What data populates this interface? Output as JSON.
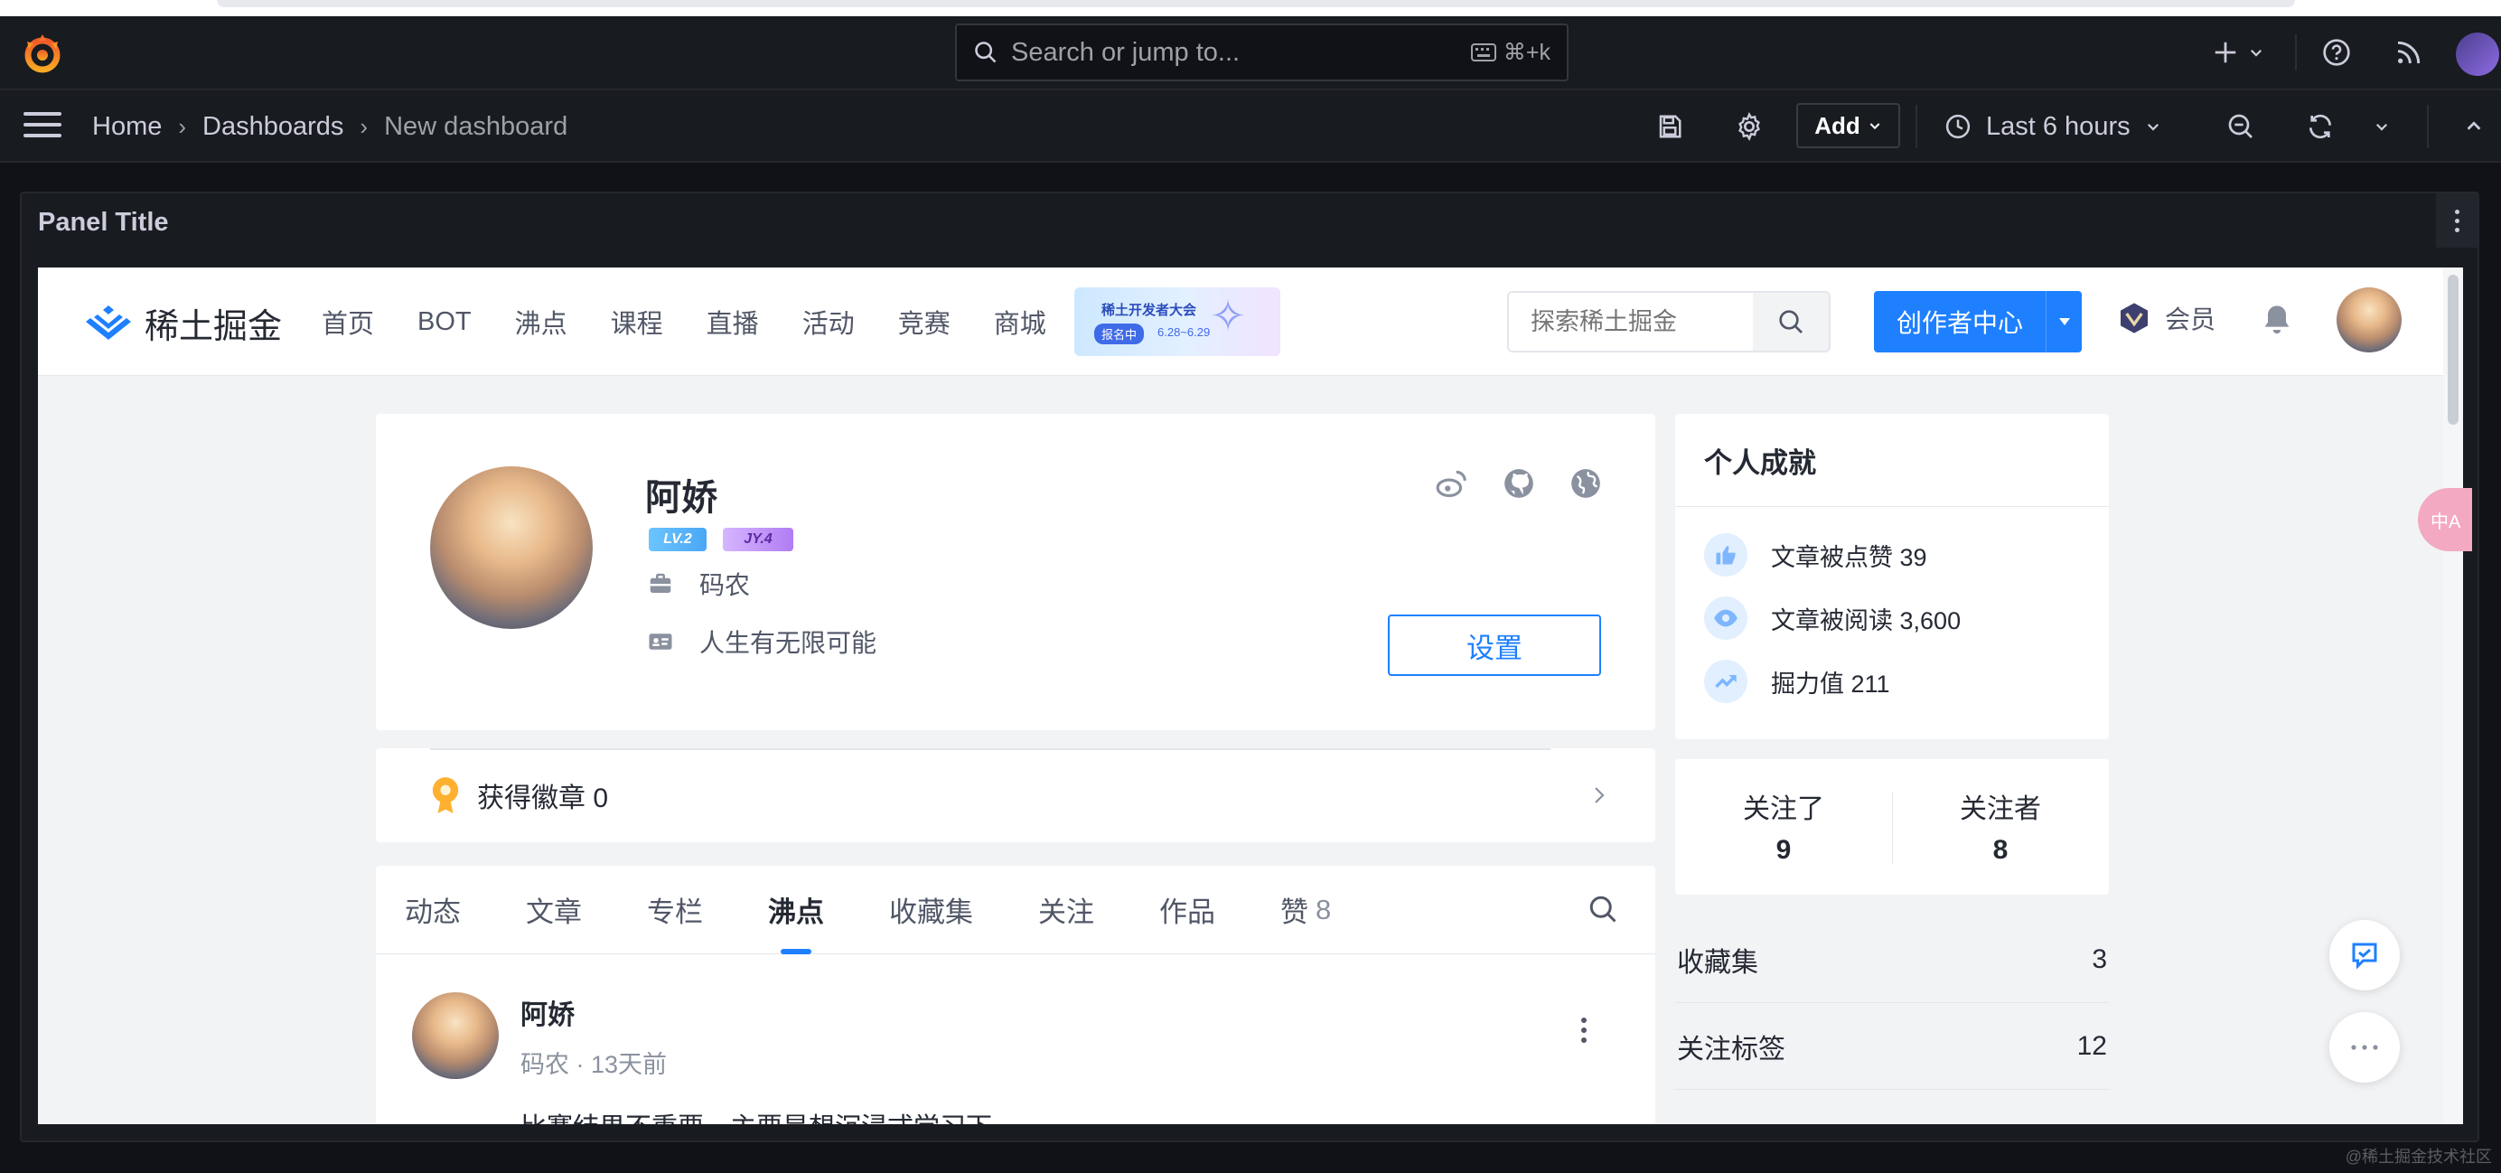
{
  "grafana": {
    "search": {
      "placeholder": "Search or jump to...",
      "shortcut": "⌘+k"
    },
    "breadcrumb": [
      "Home",
      "Dashboards",
      "New dashboard"
    ],
    "toolbar": {
      "add_label": "Add",
      "time_range": "Last 6 hours"
    },
    "panel": {
      "title": "Panel Title"
    }
  },
  "juejin": {
    "logo_text": "稀土掘金",
    "nav_links": [
      "首页",
      "BOT",
      "沸点",
      "课程",
      "直播",
      "活动",
      "竞赛",
      "商城"
    ],
    "banner": {
      "title": "稀土开发者大会",
      "tag": "报名中",
      "dates": "6.28~6.29"
    },
    "search_placeholder": "探索稀土掘金",
    "creator_button": "创作者中心",
    "vip_label": "会员",
    "profile": {
      "name": "阿娇",
      "level_badge": "LV.2",
      "jy_badge": "JY.4",
      "job": "码农",
      "bio": "人生有无限可能",
      "settings_button": "设置"
    },
    "badges": {
      "label": "获得徽章 0"
    },
    "tabs": [
      {
        "label": "动态",
        "count": ""
      },
      {
        "label": "文章",
        "count": ""
      },
      {
        "label": "专栏",
        "count": ""
      },
      {
        "label": "沸点",
        "count": "",
        "active": true
      },
      {
        "label": "收藏集",
        "count": ""
      },
      {
        "label": "关注",
        "count": ""
      },
      {
        "label": "作品",
        "count": ""
      },
      {
        "label": "赞",
        "count": "8"
      }
    ],
    "feed_item": {
      "author": "阿娇",
      "meta": "码农 · 13天前",
      "text": "比赛结果不重要，主要是想沉浸式学习下"
    },
    "achievements": {
      "title": "个人成就",
      "items": [
        {
          "label": "文章被点赞",
          "value": "39",
          "icon": "thumbs-up-icon"
        },
        {
          "label": "文章被阅读",
          "value": "3,600",
          "icon": "eye-icon"
        },
        {
          "label": "掘力值",
          "value": "211",
          "icon": "trend-up-icon"
        }
      ]
    },
    "follow": {
      "following_label": "关注了",
      "following": "9",
      "followers_label": "关注者",
      "followers": "8"
    },
    "stats": [
      {
        "label": "收藏集",
        "value": "3"
      },
      {
        "label": "关注标签",
        "value": "12"
      }
    ],
    "edge_bubble": "中A"
  },
  "watermark": "@稀土掘金技术社区",
  "colors": {
    "grafana_bg": "#111217",
    "juejin_blue": "#1e80ff",
    "juejin_bg": "#f2f3f5"
  }
}
